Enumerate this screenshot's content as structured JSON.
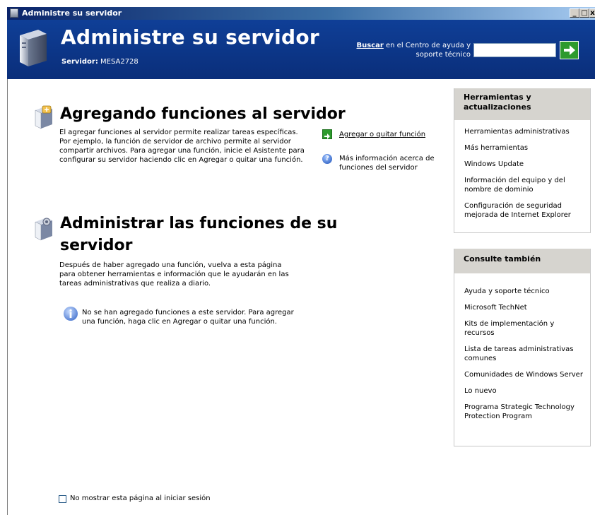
{
  "window": {
    "title": "Administre su servidor",
    "buttons": {
      "minimize": "_",
      "maximize": "□",
      "close": "x"
    }
  },
  "header": {
    "title": "Administre su servidor",
    "server_label": "Servidor:",
    "server_name": "MESA2728",
    "search_keyword": "Buscar",
    "search_text_rest": " en el Centro de ayuda y soporte técnico",
    "search_value": ""
  },
  "section_add": {
    "title": "Agregando funciones al servidor",
    "description": "El agregar funciones al servidor permite realizar tareas específicas. Por ejemplo, la función de servidor de archivo permite al servidor compartir archivos. Para agregar una función, inicie el Asistente para configurar su servidor haciendo clic en Agregar o quitar una función.",
    "actions": {
      "add_remove": "Agregar o quitar función",
      "more_info": "Más información acerca de funciones del servidor"
    }
  },
  "section_manage": {
    "title_line1": "Administrar las funciones de su",
    "title_line2": "servidor",
    "description": "Después de haber agregado una función, vuelva a esta página para obtener herramientas e información que le ayudarán en las tareas administrativas que realiza a diario.",
    "info_message": "No se han agregado funciones a este servidor. Para agregar una función, haga clic en Agregar o quitar una función."
  },
  "tools_panel": {
    "title": "Herramientas y actualizaciones",
    "items": [
      "Herramientas administrativas",
      "Más herramientas",
      "Windows Update",
      "Información del equipo y del nombre de dominio",
      "Configuración de seguridad mejorada de Internet Explorer"
    ]
  },
  "see_also_panel": {
    "title": "Consulte también",
    "items": [
      "Ayuda y soporte técnico",
      "Microsoft TechNet",
      "Kits de implementación y recursos",
      "Lista de tareas administrativas comunes",
      "Comunidades de Windows Server",
      "Lo nuevo",
      "Programa Strategic Technology Protection Program"
    ]
  },
  "footer": {
    "checkbox_label": "No mostrar esta página al iniciar sesión",
    "checked": false
  },
  "colors": {
    "header_bg": "#0d3b91",
    "titlebar_start": "#0a246a",
    "panel_head": "#d6d4cf",
    "go_green": "#2d9a2d"
  }
}
